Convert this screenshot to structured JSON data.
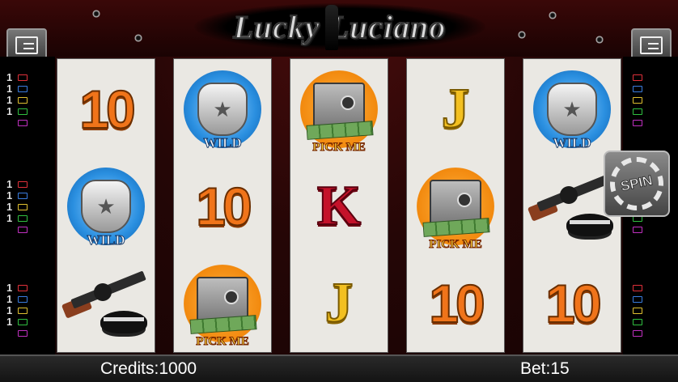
{
  "title": "Lucky Luciano",
  "footer": {
    "credits_label": "Credits:",
    "credits": "1000",
    "bet_label": "Bet:",
    "bet": "15"
  },
  "controls": {
    "left_menu_icon": "paytable-icon",
    "right_menu_icon": "menu-icon",
    "spin_label": "SPIN"
  },
  "paylines": {
    "mark": "1",
    "colors": [
      "#e0303a",
      "#3a7de0",
      "#e0c030",
      "#30c040",
      "#c030c0"
    ]
  },
  "reels": [
    [
      {
        "type": "ten",
        "text": "10"
      },
      {
        "type": "wild",
        "text": "WILD"
      },
      {
        "type": "gun",
        "text": ""
      }
    ],
    [
      {
        "type": "wild",
        "text": "WILD"
      },
      {
        "type": "ten",
        "text": "10"
      },
      {
        "type": "pick",
        "text": "PICK ME"
      }
    ],
    [
      {
        "type": "pick",
        "text": "PICK ME"
      },
      {
        "type": "king",
        "text": "K"
      },
      {
        "type": "jack",
        "text": "J"
      }
    ],
    [
      {
        "type": "jack",
        "text": "J"
      },
      {
        "type": "pick",
        "text": "PICK ME"
      },
      {
        "type": "ten",
        "text": "10"
      }
    ],
    [
      {
        "type": "wild",
        "text": "WILD"
      },
      {
        "type": "gun",
        "text": ""
      },
      {
        "type": "ten",
        "text": "10"
      }
    ]
  ]
}
